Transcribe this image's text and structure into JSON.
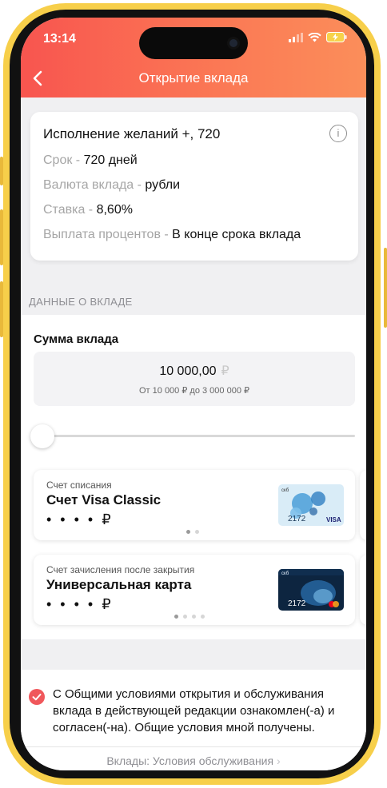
{
  "status": {
    "time": "13:14"
  },
  "nav": {
    "title": "Открытие вклада"
  },
  "deposit": {
    "title": "Исполнение желаний +, 720",
    "term_label": "Срок - ",
    "term_value": "720 дней",
    "currency_label": "Валюта вклада - ",
    "currency_value": "рубли",
    "rate_label": "Ставка - ",
    "rate_value": "8,60%",
    "payout_label": "Выплата процентов - ",
    "payout_value": "В конце срока вклада"
  },
  "section": {
    "title": "ДАННЫЕ О ВКЛАДЕ"
  },
  "amount": {
    "label": "Сумма вклада",
    "value": "10 000,00",
    "currency": "₽",
    "hint": "От 10 000 ₽ до 3 000 000 ₽",
    "slider_fraction": 0.0
  },
  "debit_account": {
    "caption": "Счет списания",
    "name": "Счет Visa Classic",
    "balance": "• • • • ₽",
    "card_last4": "2172",
    "card_brand": "VISA",
    "card_bank": "скб",
    "page_dots": 2,
    "active_dot": 0
  },
  "credit_account": {
    "caption": "Счет зачисления после закрытия",
    "name": "Универсальная карта",
    "balance": "• • • • ₽",
    "card_last4": "2172",
    "card_bank": "скб",
    "page_dots": 4,
    "active_dot": 0
  },
  "terms": {
    "text": "С Общими условиями открытия и обслуживания вклада в действующей редакции ознакомлен(-а) и согласен(-на). Общие условия мной получены.",
    "checked": true
  },
  "footer": {
    "link": "Вклады: Условия обслуживания"
  },
  "colors": {
    "accent": "#f8554f",
    "accent_end": "#fb8e5a",
    "check": "#f0575b"
  }
}
